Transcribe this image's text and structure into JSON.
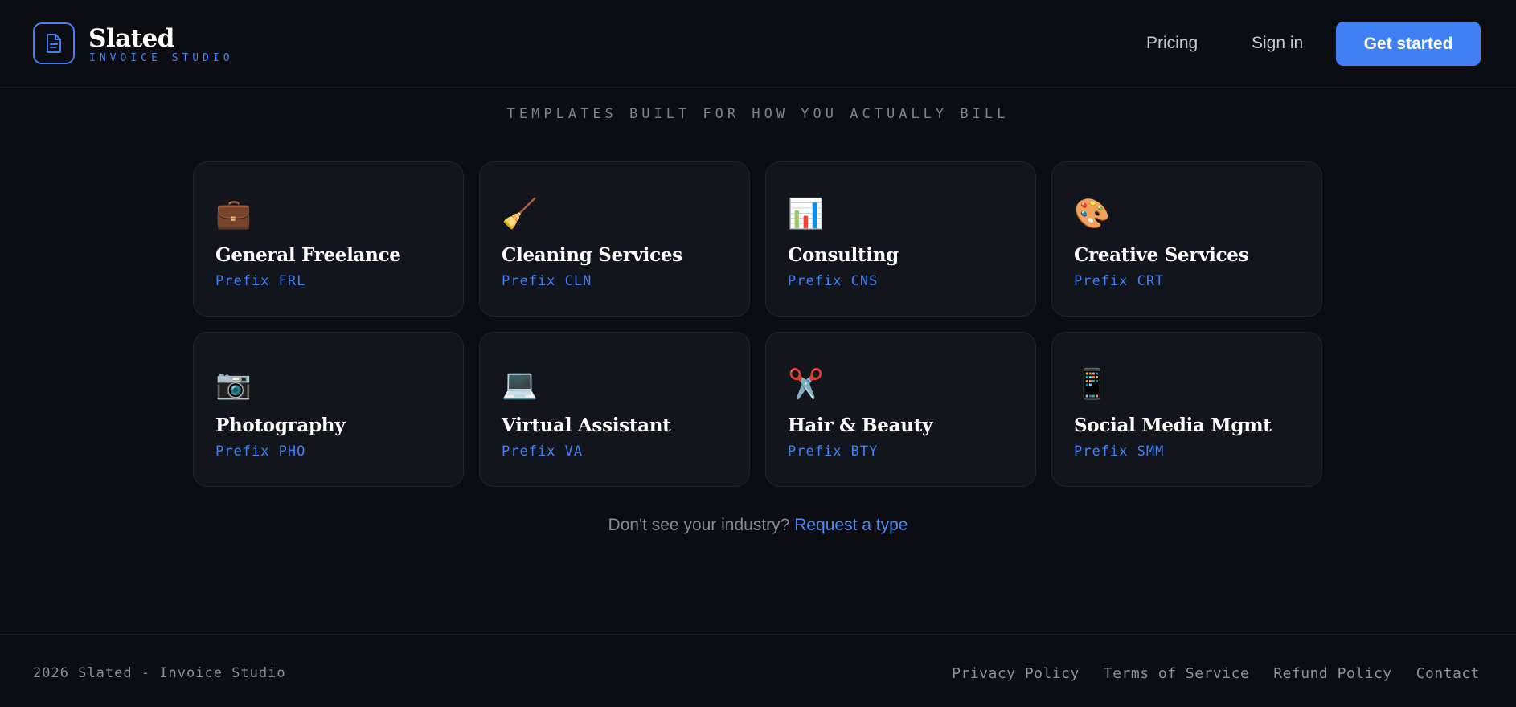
{
  "header": {
    "brand_name": "Slated",
    "brand_sub": "INVOICE STUDIO",
    "nav": {
      "pricing": "Pricing",
      "signin": "Sign in",
      "cta": "Get started"
    }
  },
  "section": {
    "eyebrow": "TEMPLATES BUILT FOR HOW YOU ACTUALLY BILL",
    "cards": [
      {
        "title": "General Freelance",
        "prefix": "Prefix FRL",
        "icon": "briefcase-icon",
        "glyph": "💼"
      },
      {
        "title": "Cleaning Services",
        "prefix": "Prefix CLN",
        "icon": "broom-icon",
        "glyph": "🧹"
      },
      {
        "title": "Consulting",
        "prefix": "Prefix CNS",
        "icon": "bar-chart-icon",
        "glyph": "📊"
      },
      {
        "title": "Creative Services",
        "prefix": "Prefix CRT",
        "icon": "palette-icon",
        "glyph": "🎨"
      },
      {
        "title": "Photography",
        "prefix": "Prefix PHO",
        "icon": "camera-icon",
        "glyph": "📷"
      },
      {
        "title": "Virtual Assistant",
        "prefix": "Prefix VA",
        "icon": "laptop-icon",
        "glyph": "💻"
      },
      {
        "title": "Hair & Beauty",
        "prefix": "Prefix BTY",
        "icon": "scissors-icon",
        "glyph": "✂️"
      },
      {
        "title": "Social Media Mgmt",
        "prefix": "Prefix SMM",
        "icon": "mobile-phone-icon",
        "glyph": "📱"
      }
    ],
    "request_text": "Don't see your industry?",
    "request_link": "Request a type"
  },
  "footer": {
    "copyright": "2026 Slated - Invoice Studio",
    "links": {
      "privacy": "Privacy Policy",
      "terms": "Terms of Service",
      "refund": "Refund Policy",
      "contact": "Contact"
    }
  },
  "colors": {
    "accent": "#3f80f5",
    "background": "#0b0d12",
    "card": "#12151c"
  }
}
